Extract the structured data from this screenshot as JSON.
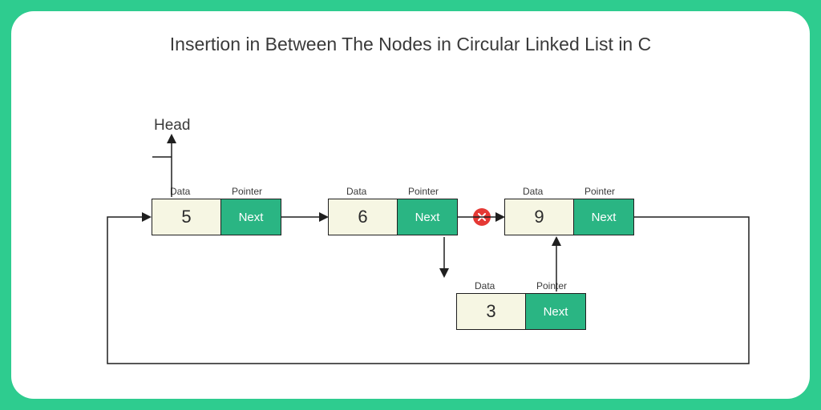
{
  "title": "Insertion in Between The Nodes in Circular Linked List in C",
  "labels": {
    "head": "Head",
    "data": "Data",
    "pointer": "Pointer",
    "next": "Next"
  },
  "nodes": {
    "n1": {
      "value": "5"
    },
    "n2": {
      "value": "6"
    },
    "n3": {
      "value": "9"
    },
    "inserted": {
      "value": "3"
    }
  },
  "badge": {
    "icon_name": "cross-icon"
  },
  "colors": {
    "frame": "#2ecc8f",
    "node_data_bg": "#f6f6e3",
    "node_ptr_bg": "#2ab583",
    "badge_bg": "#e53935"
  }
}
